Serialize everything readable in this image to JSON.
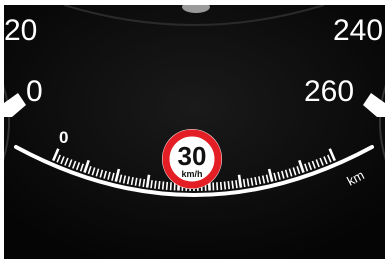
{
  "cluster": {
    "left_gauge": {
      "labels": [
        "20",
        "0"
      ]
    },
    "right_gauge": {
      "labels": [
        "240",
        "260"
      ]
    },
    "scale": {
      "start_label": "0",
      "unit_label": "km"
    },
    "speed_limit_sign": {
      "value": "30",
      "unit": "km/h",
      "ring_color": "#e31e24"
    },
    "colors": {
      "background": "#0a0a0a",
      "scale": "#ffffff",
      "needle_tip": "#e8e8e8"
    }
  }
}
